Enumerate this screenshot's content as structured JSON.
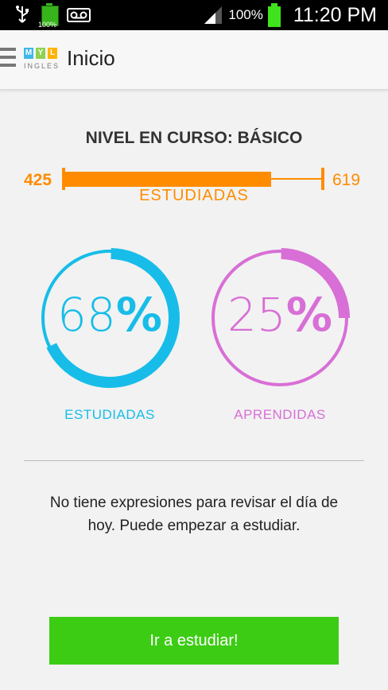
{
  "status_bar": {
    "small_battery_pct": "100%",
    "battery_pct": "100%",
    "time": "11:20 PM",
    "icons": [
      "usb-icon",
      "battery-icon",
      "voicemail-icon",
      "signal-icon",
      "battery-full-icon"
    ]
  },
  "app_bar": {
    "title": "Inicio",
    "logo_letters": [
      "M",
      "Y",
      "L"
    ],
    "logo_word": "INGLES",
    "colors": {
      "logo_m": "#3eb7e8",
      "logo_y": "#8fd14f",
      "logo_l": "#ffb300"
    }
  },
  "level": {
    "title": "NIVEL EN CURSO: BÁSICO",
    "min": "425",
    "max": "619",
    "progress_fraction": 0.8,
    "label": "ESTUDIADAS",
    "color": "#ff8c00"
  },
  "stats": [
    {
      "value": "68",
      "symbol": "%",
      "fraction": 0.68,
      "label": "ESTUDIADAS",
      "color": "#17bde8"
    },
    {
      "value": "25",
      "symbol": "%",
      "fraction": 0.25,
      "label": "APRENDIDAS",
      "color": "#d86fd6"
    }
  ],
  "message": "No tiene expresiones para revisar el día de hoy. Puede empezar a estudiar.",
  "cta_label": "Ir a estudiar!"
}
